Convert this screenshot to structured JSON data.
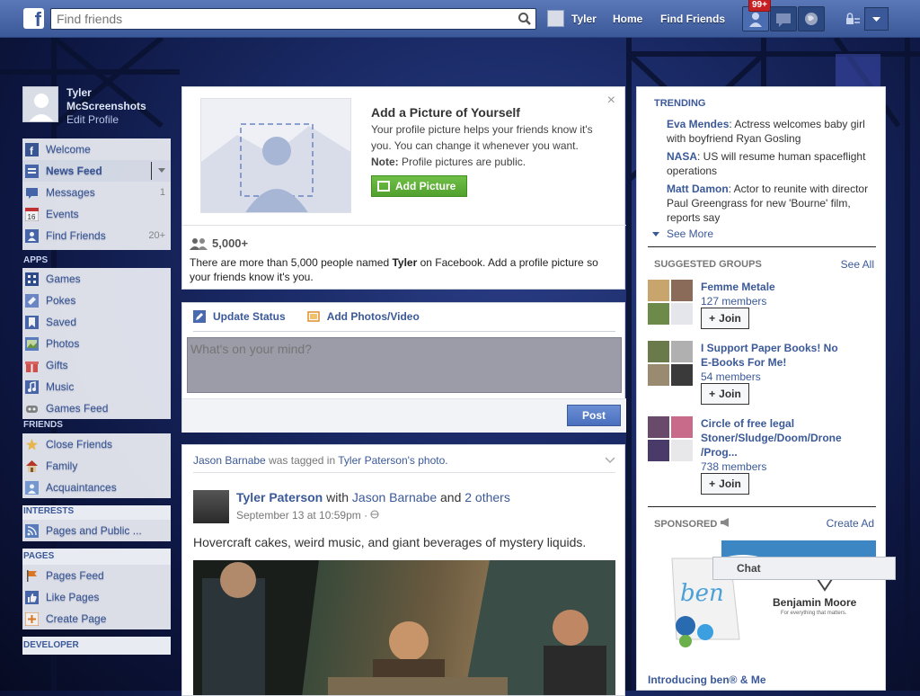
{
  "topbar": {
    "logo": "f",
    "search_placeholder": "Find friends",
    "user_name": "Tyler",
    "home": "Home",
    "find_friends": "Find Friends",
    "notif_badge": "99+"
  },
  "profile": {
    "name_line1": "Tyler",
    "name_line2": "McScreenshots",
    "edit": "Edit Profile"
  },
  "nav": {
    "main": [
      {
        "label": "Welcome",
        "count": ""
      },
      {
        "label": "News Feed",
        "count": ""
      },
      {
        "label": "Messages",
        "count": "1"
      },
      {
        "label": "Events",
        "count": ""
      },
      {
        "label": "Find Friends",
        "count": "20+"
      }
    ],
    "apps_header": "APPS",
    "apps": [
      "Games",
      "Pokes",
      "Saved",
      "Photos",
      "Gifts",
      "Music",
      "Games Feed"
    ],
    "friends_header": "FRIENDS",
    "friends": [
      "Close Friends",
      "Family",
      "Acquaintances"
    ],
    "interests_header": "INTERESTS",
    "interests": [
      "Pages and Public ..."
    ],
    "pages_header": "PAGES",
    "pages": [
      "Pages Feed",
      "Like Pages",
      "Create Page"
    ],
    "developer_header": "DEVELOPER",
    "events_date": "16"
  },
  "addpic": {
    "title": "Add a Picture of Yourself",
    "desc": "Your profile picture helps your friends know it's you. You can change it whenever you want.",
    "note_label": "Note:",
    "note_text": " Profile pictures are public.",
    "button": "Add Picture",
    "count": "5,000+",
    "count_desc_pre": "There are more than 5,000 people named ",
    "count_desc_name": "Tyler",
    "count_desc_post": " on Facebook. Add a profile picture so your friends know it's you.",
    "close": "×"
  },
  "composer": {
    "tab1": "Update Status",
    "tab2": "Add Photos/Video",
    "placeholder": "What's on your mind?",
    "post": "Post"
  },
  "story": {
    "tag_actor": "Jason Barnabe",
    "tag_mid": " was tagged in ",
    "tag_target": "Tyler Paterson's photo.",
    "author": "Tyler Paterson",
    "with": " with ",
    "with_person": "Jason Barnabe",
    "and": " and ",
    "others": "2 others",
    "time": "September 13 at 10:59pm · ",
    "text": "Hovercraft cakes, weird music, and giant beverages of mystery liquids."
  },
  "trending": {
    "header": "TRENDING",
    "items": [
      {
        "name": "Eva Mendes",
        "text": ": Actress welcomes baby girl with boyfriend Ryan Gosling"
      },
      {
        "name": "NASA",
        "text": ": US will resume human spaceflight operations"
      },
      {
        "name": "Matt Damon",
        "text": ": Actor to reunite with director Paul Greengrass for new 'Bourne' film, reports say"
      }
    ],
    "see_more": "See More"
  },
  "groups": {
    "header": "SUGGESTED GROUPS",
    "see_all": "See All",
    "items": [
      {
        "name": "Femme Metale",
        "members": "127 members",
        "join": "Join"
      },
      {
        "name": "I Support Paper Books! No E-Books For Me!",
        "members": "54 members",
        "join": "Join"
      },
      {
        "name": "Circle of free legal Stoner/Sludge/Doom/Drone /Prog...",
        "members": "738 members",
        "join": "Join"
      }
    ]
  },
  "sponsored": {
    "header": "SPONSORED",
    "create_ad": "Create Ad",
    "ad_brand": "Benjamin Moore",
    "ad_tagline": "For everything that matters.",
    "ad_logo_text": "ben",
    "ad_title": "Introducing ben® & Me"
  },
  "chat": {
    "label": "Chat"
  },
  "colors": {
    "brand": "#3b5998",
    "badge": "#c72023",
    "green": "#52a12e"
  }
}
